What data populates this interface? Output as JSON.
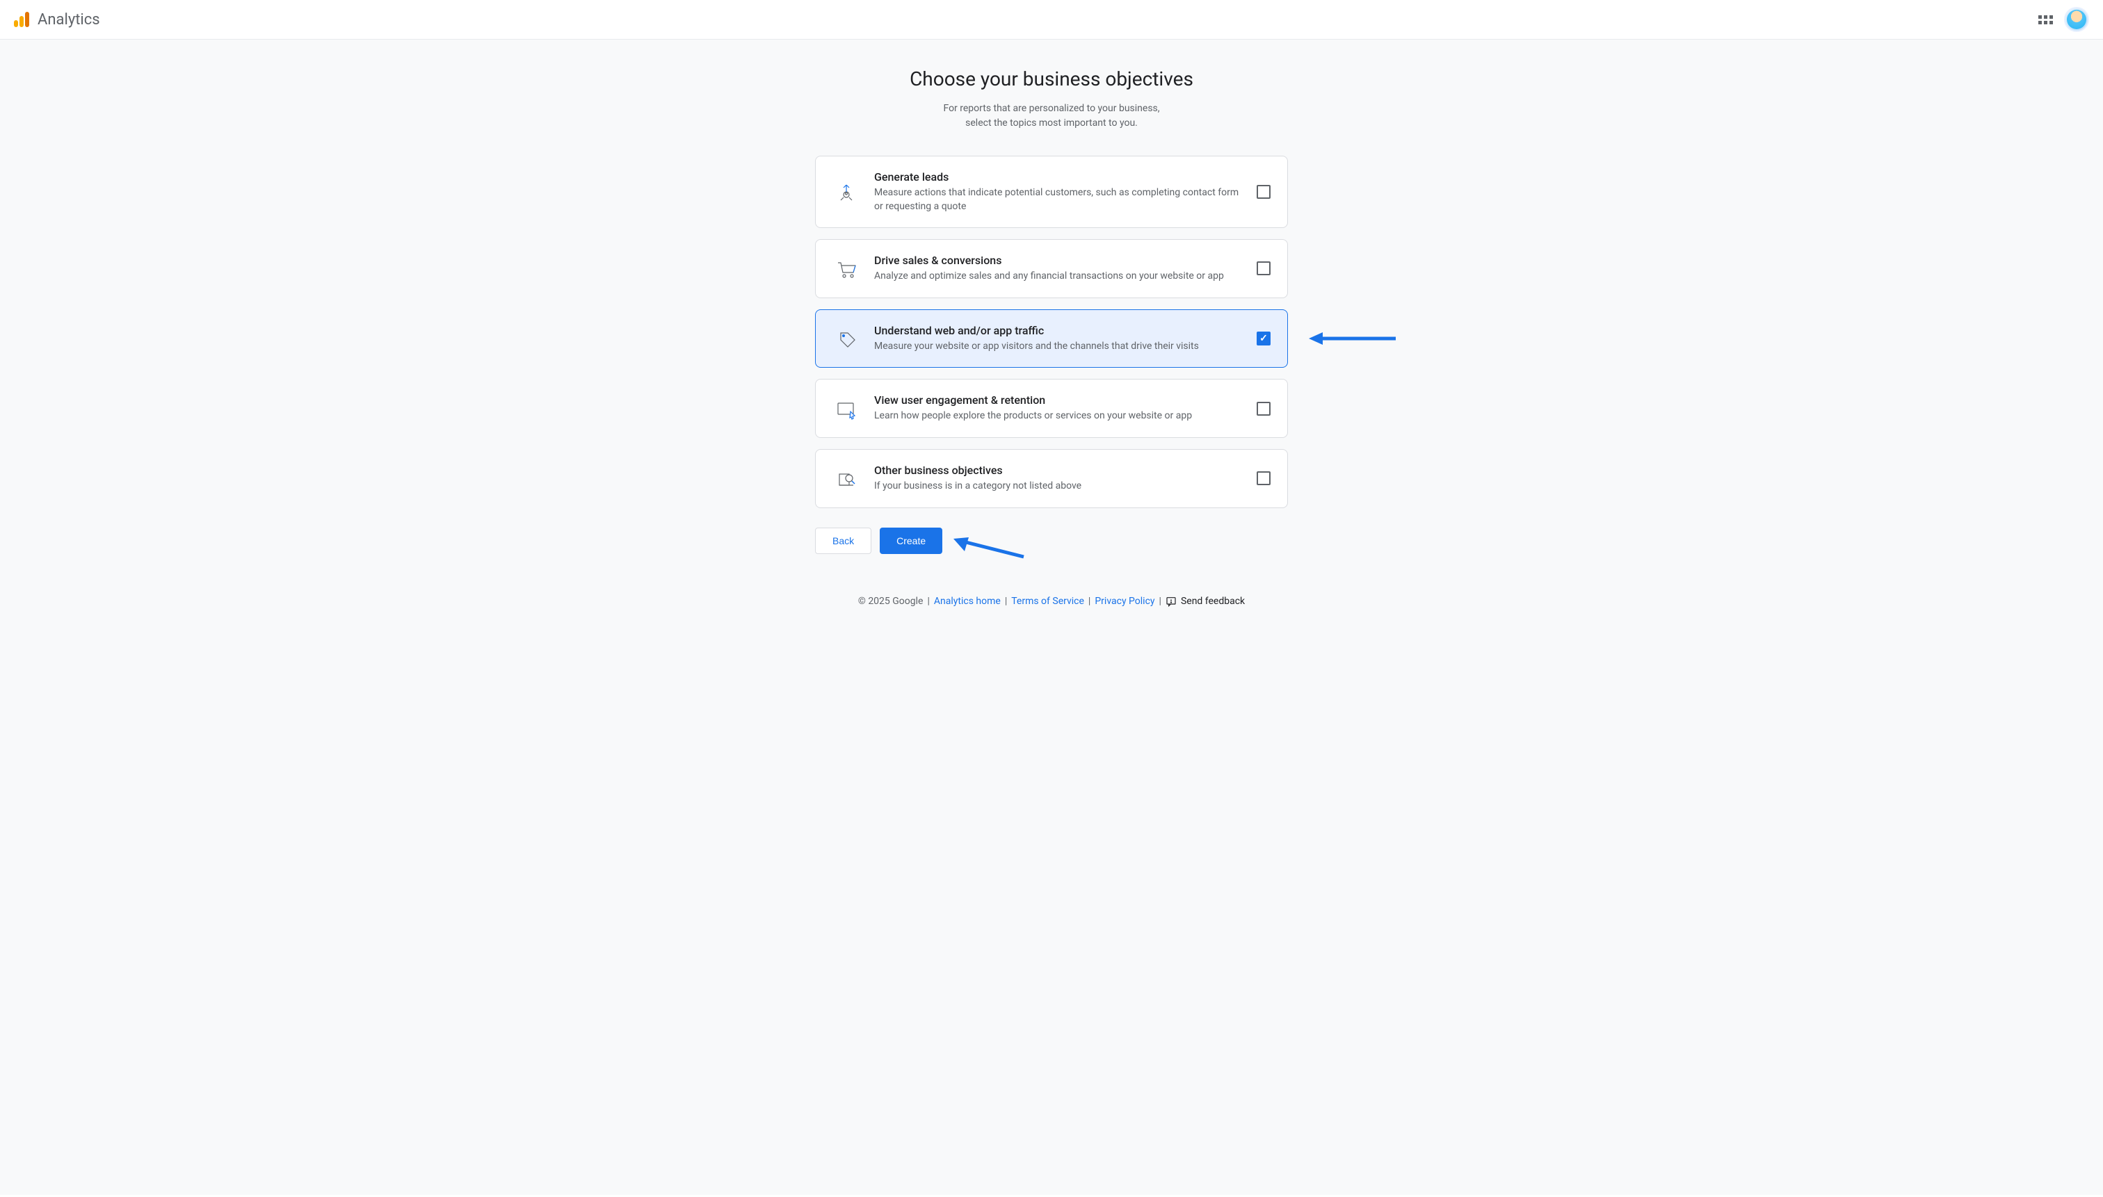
{
  "header": {
    "product_name": "Analytics"
  },
  "page": {
    "title": "Choose your business objectives",
    "subtitle_line1": "For reports that are personalized to your business,",
    "subtitle_line2": "select the topics most important to you."
  },
  "objectives": [
    {
      "title": "Generate leads",
      "description": "Measure actions that indicate potential customers, such as completing contact form or requesting a quote",
      "checked": false,
      "icon": "leads"
    },
    {
      "title": "Drive sales & conversions",
      "description": "Analyze and optimize sales and any financial transactions on your website or app",
      "checked": false,
      "icon": "cart"
    },
    {
      "title": "Understand web and/or app traffic",
      "description": "Measure your website or app visitors and the channels that drive their visits",
      "checked": true,
      "icon": "tag"
    },
    {
      "title": "View user engagement & retention",
      "description": "Learn how people explore the products or services on your website or app",
      "checked": false,
      "icon": "screen"
    },
    {
      "title": "Other business objectives",
      "description": "If your business is in a category not listed above",
      "checked": false,
      "icon": "search"
    }
  ],
  "buttons": {
    "back": "Back",
    "create": "Create"
  },
  "footer": {
    "copyright": "© 2025 Google",
    "links": {
      "home": "Analytics home",
      "terms": "Terms of Service",
      "privacy": "Privacy Policy"
    },
    "feedback": "Send feedback"
  },
  "annotations": {
    "arrow_color": "#1a73e8"
  }
}
